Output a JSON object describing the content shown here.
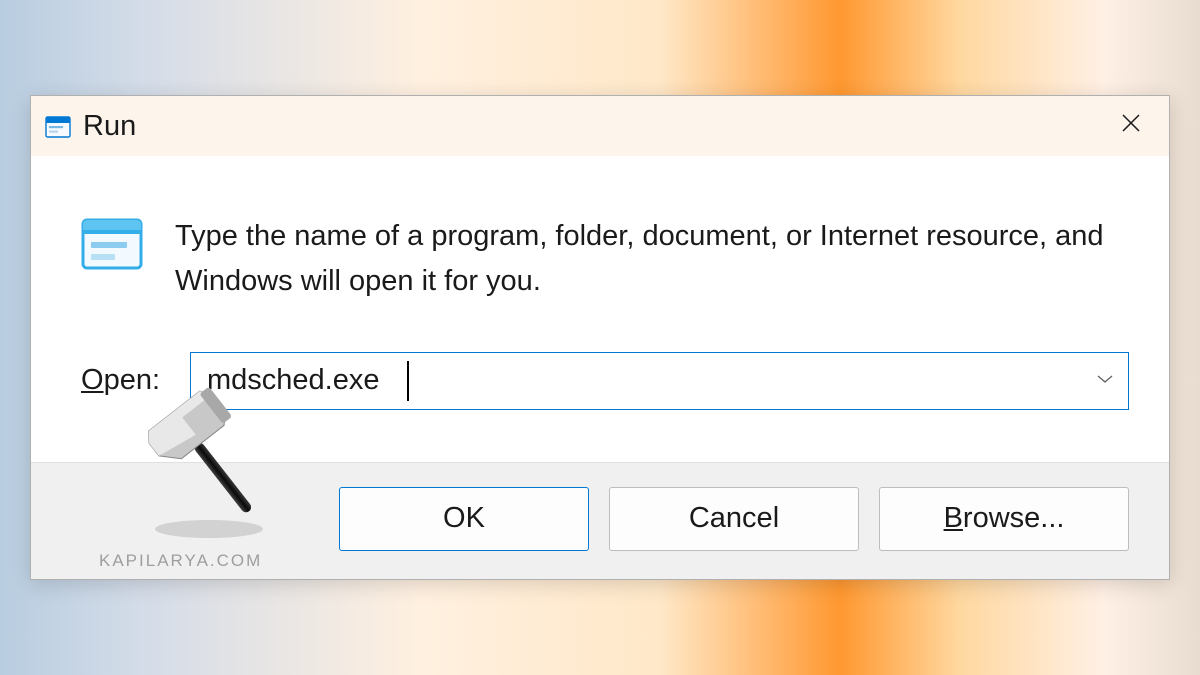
{
  "title": "Run",
  "description": "Type the name of a program, folder, document, or Internet resource, and Windows will open it for you.",
  "open_label_prefix": "O",
  "open_label_rest": "pen:",
  "input_value": "mdsched.exe",
  "buttons": {
    "ok": "OK",
    "cancel": "Cancel",
    "browse_prefix": "B",
    "browse_rest": "rowse..."
  },
  "watermark": "KAPILARYA.COM"
}
